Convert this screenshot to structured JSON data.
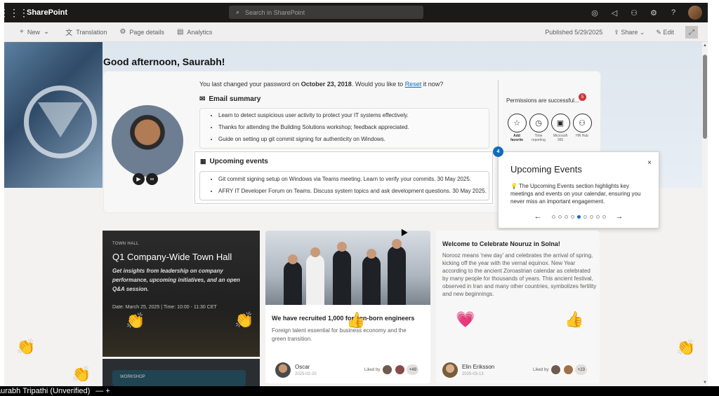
{
  "app": {
    "name": "SharePoint"
  },
  "search": {
    "placeholder": "Search in SharePoint"
  },
  "command_bar": {
    "new_label": "New",
    "translation_label": "Translation",
    "page_details_label": "Page details",
    "analytics_label": "Analytics",
    "published_label": "Published 5/29/2025",
    "share_label": "Share",
    "edit_label": "Edit"
  },
  "greeting": "Good afternoon, Saurabh!",
  "password": {
    "prefix": "You last changed your password on ",
    "date": "October 23, 2018",
    "middle": ". Would you like to ",
    "link": "Reset",
    "suffix": " it now?"
  },
  "email_summary": {
    "title": "Email summary",
    "items": [
      "Learn to detect suspicious user activity to protect your IT systems effectively.",
      "Thanks for attending the Building Solutions workshop; feedback appreciated.",
      "Guide on setting up git commit signing for authenticity on Windows."
    ]
  },
  "permissions": {
    "title": "Permissions are successful...",
    "badge": "5",
    "apps": [
      {
        "label": "Add favorite",
        "icon": "star-add-icon",
        "bold": true
      },
      {
        "label": "Time reporting",
        "icon": "clock-icon",
        "bold": false
      },
      {
        "label": "Microsoft 365",
        "icon": "office-icon",
        "bold": false
      },
      {
        "label": "HR Hub",
        "icon": "people-icon",
        "bold": false
      }
    ]
  },
  "upcoming_events": {
    "title": "Upcoming events",
    "items": [
      "Git commit signing setup on Windows via Teams meeting. Learn to verify your commits. 30 May 2025.",
      "AFRY IT Developer Forum on Teams. Discuss system topics and ask development questions. 30 May 2025."
    ]
  },
  "tour": {
    "step": "4",
    "title": "Upcoming Events",
    "body": "💡 The Upcoming Events section highlights key meetings and events on your calendar, ensuring you never miss an important engagement.",
    "close": "×",
    "prev": "←",
    "next": "→",
    "total_dots": 9,
    "active_dot": 4
  },
  "news": {
    "townhall": {
      "tag": "TOWN HALL",
      "title": "Q1 Company-Wide Town Hall",
      "desc": "Get insights from leadership on company performance, upcoming initiatives, and an open Q&A session.",
      "date": "Date: March 25, 2025 | Time: 10:00 - 11:30 CET"
    },
    "workshop": {
      "tag": "WORKSHOP"
    },
    "recruited": {
      "title": "We have recruited 1,000 foreign-born engineers",
      "desc": "Foreign talent essential for business economy and the green transition.",
      "author": "Oscar",
      "date": "2025-02-20",
      "liked_label": "Liked by",
      "count": "+49"
    },
    "nouruz": {
      "title": "Welcome to Celebrate Nouruz in Solna!",
      "desc": "Norooz means 'new day' and celebrates the arrival of spring, kicking off the year with the vernal equinox. New Year according to the ancient Zoroastrian calendar as celebrated by many people for thousands of years. This ancient festival, observed in Iran and many other countries, symbolizes fertility and new beginnings.",
      "author": "Elin Eriksson",
      "date": "2025-03-13",
      "liked_label": "Liked by",
      "count": "+23"
    }
  },
  "reactions": {
    "clap": "👏",
    "thumb": "👍",
    "heart": "💗"
  },
  "taskbar": {
    "title": "aurabh Tripathi (Unverified)",
    "controls": "—   +"
  }
}
